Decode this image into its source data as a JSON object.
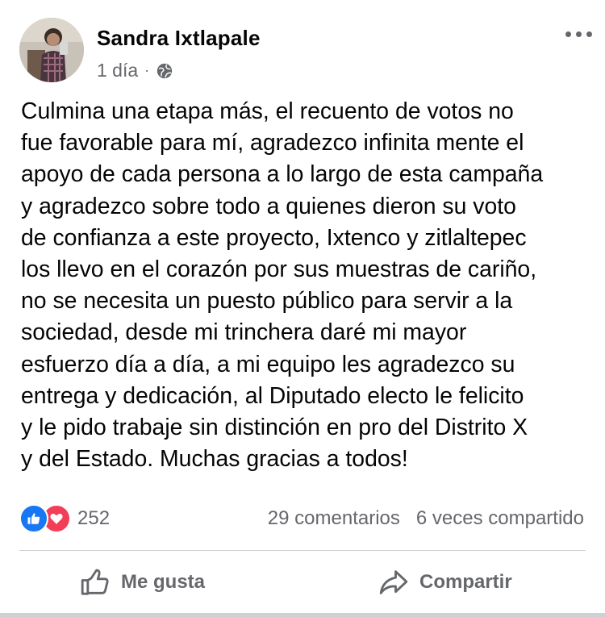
{
  "post": {
    "author": "Sandra Ixtlapale",
    "time": "1 día",
    "separator": "·",
    "audience_icon": "globe-icon",
    "more_icon": "more-horizontal-icon",
    "text": "Culmina una etapa más, el recuento de votos no\nfue favorable para mí, agradezco infinita mente el\napoyo de cada persona a lo largo de esta campaña\ny agradezco sobre todo a quienes dieron su voto\nde confianza a este proyecto, Ixtenco y zitlaltepec\nlos llevo en el corazón por sus muestras de cariño,\nno se necesita un puesto público para servir a la\nsociedad, desde mi trinchera daré mi mayor\nesfuerzo día a día, a mi equipo les agradezco su\nentrega y dedicación, al Diputado electo le felicito\ny le pido trabaje sin distinción en pro del Distrito X\ny del Estado. Muchas gracias a todos!"
  },
  "stats": {
    "reactions_count": "252",
    "reaction_icons": [
      "like-icon",
      "love-icon"
    ],
    "comments": "29 comentarios",
    "shares": "6 veces compartido"
  },
  "actions": {
    "like_label": "Me gusta",
    "share_label": "Compartir"
  },
  "colors": {
    "like_blue": "#1877f2",
    "love_red": "#f33e58",
    "secondary_text": "#65676b"
  }
}
